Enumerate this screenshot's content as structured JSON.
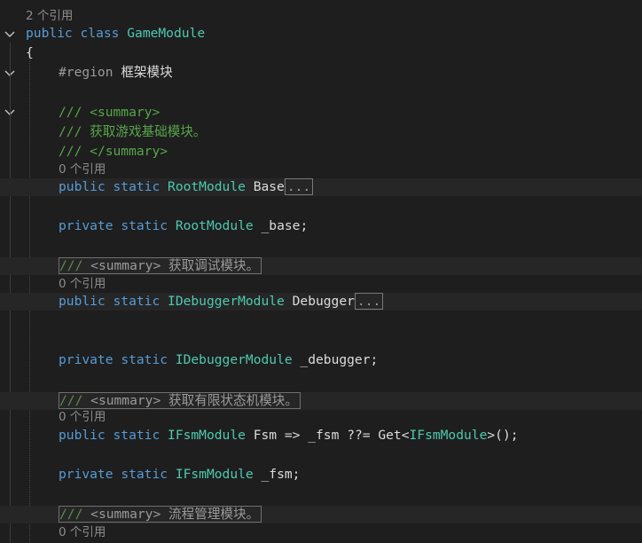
{
  "colors": {
    "background": "#1e1e1e",
    "keyword": "#569cd6",
    "type": "#4ec9b0",
    "comment": "#57a64a",
    "codelens": "#8c8c8c",
    "plain": "#dcdcdc"
  },
  "lines": {
    "l0": {
      "lens": "2 个引用"
    },
    "l1": {
      "kw1": "public",
      "kw2": "class",
      "type": "GameModule"
    },
    "l2": {
      "brace": "{"
    },
    "l3": {
      "directive": "#region",
      "name": "框架模块"
    },
    "l5": {
      "slashes": "///",
      "tag": "<summary>"
    },
    "l6": {
      "slashes": "///",
      "text": "获取游戏基础模块。"
    },
    "l7": {
      "slashes": "///",
      "tag": "</summary>"
    },
    "l8": {
      "lens": "0 个引用"
    },
    "l9": {
      "kw1": "public",
      "kw2": "static",
      "type": "RootModule",
      "name": "Base",
      "ellipsis": "..."
    },
    "l11": {
      "kw1": "private",
      "kw2": "static",
      "type": "RootModule",
      "name": "_base",
      "semi": ";"
    },
    "l13": {
      "slashes": "///",
      "tag": "<summary>",
      "text": "获取调试模块。"
    },
    "l14": {
      "lens": "0 个引用"
    },
    "l15": {
      "kw1": "public",
      "kw2": "static",
      "type": "IDebuggerModule",
      "name": "Debugger",
      "ellipsis": "..."
    },
    "l18": {
      "kw1": "private",
      "kw2": "static",
      "type": "IDebuggerModule",
      "name": "_debugger",
      "semi": ";"
    },
    "l20": {
      "slashes": "///",
      "tag": "<summary>",
      "text": "获取有限状态机模块。"
    },
    "l21": {
      "lens": "0 个引用"
    },
    "l22": {
      "kw1": "public",
      "kw2": "static",
      "type": "IFsmModule",
      "name": "Fsm",
      "arrow": "=>",
      "field": "_fsm",
      "op": "??=",
      "call": "Get",
      "lt": "<",
      "generic": "IFsmModule",
      "tail": ">();"
    },
    "l24": {
      "kw1": "private",
      "kw2": "static",
      "type": "IFsmModule",
      "name": "_fsm",
      "semi": ";"
    },
    "l26": {
      "slashes": "///",
      "tag": "<summary>",
      "text": "流程管理模块。"
    },
    "l27": {
      "lens": "0 个引用"
    }
  }
}
